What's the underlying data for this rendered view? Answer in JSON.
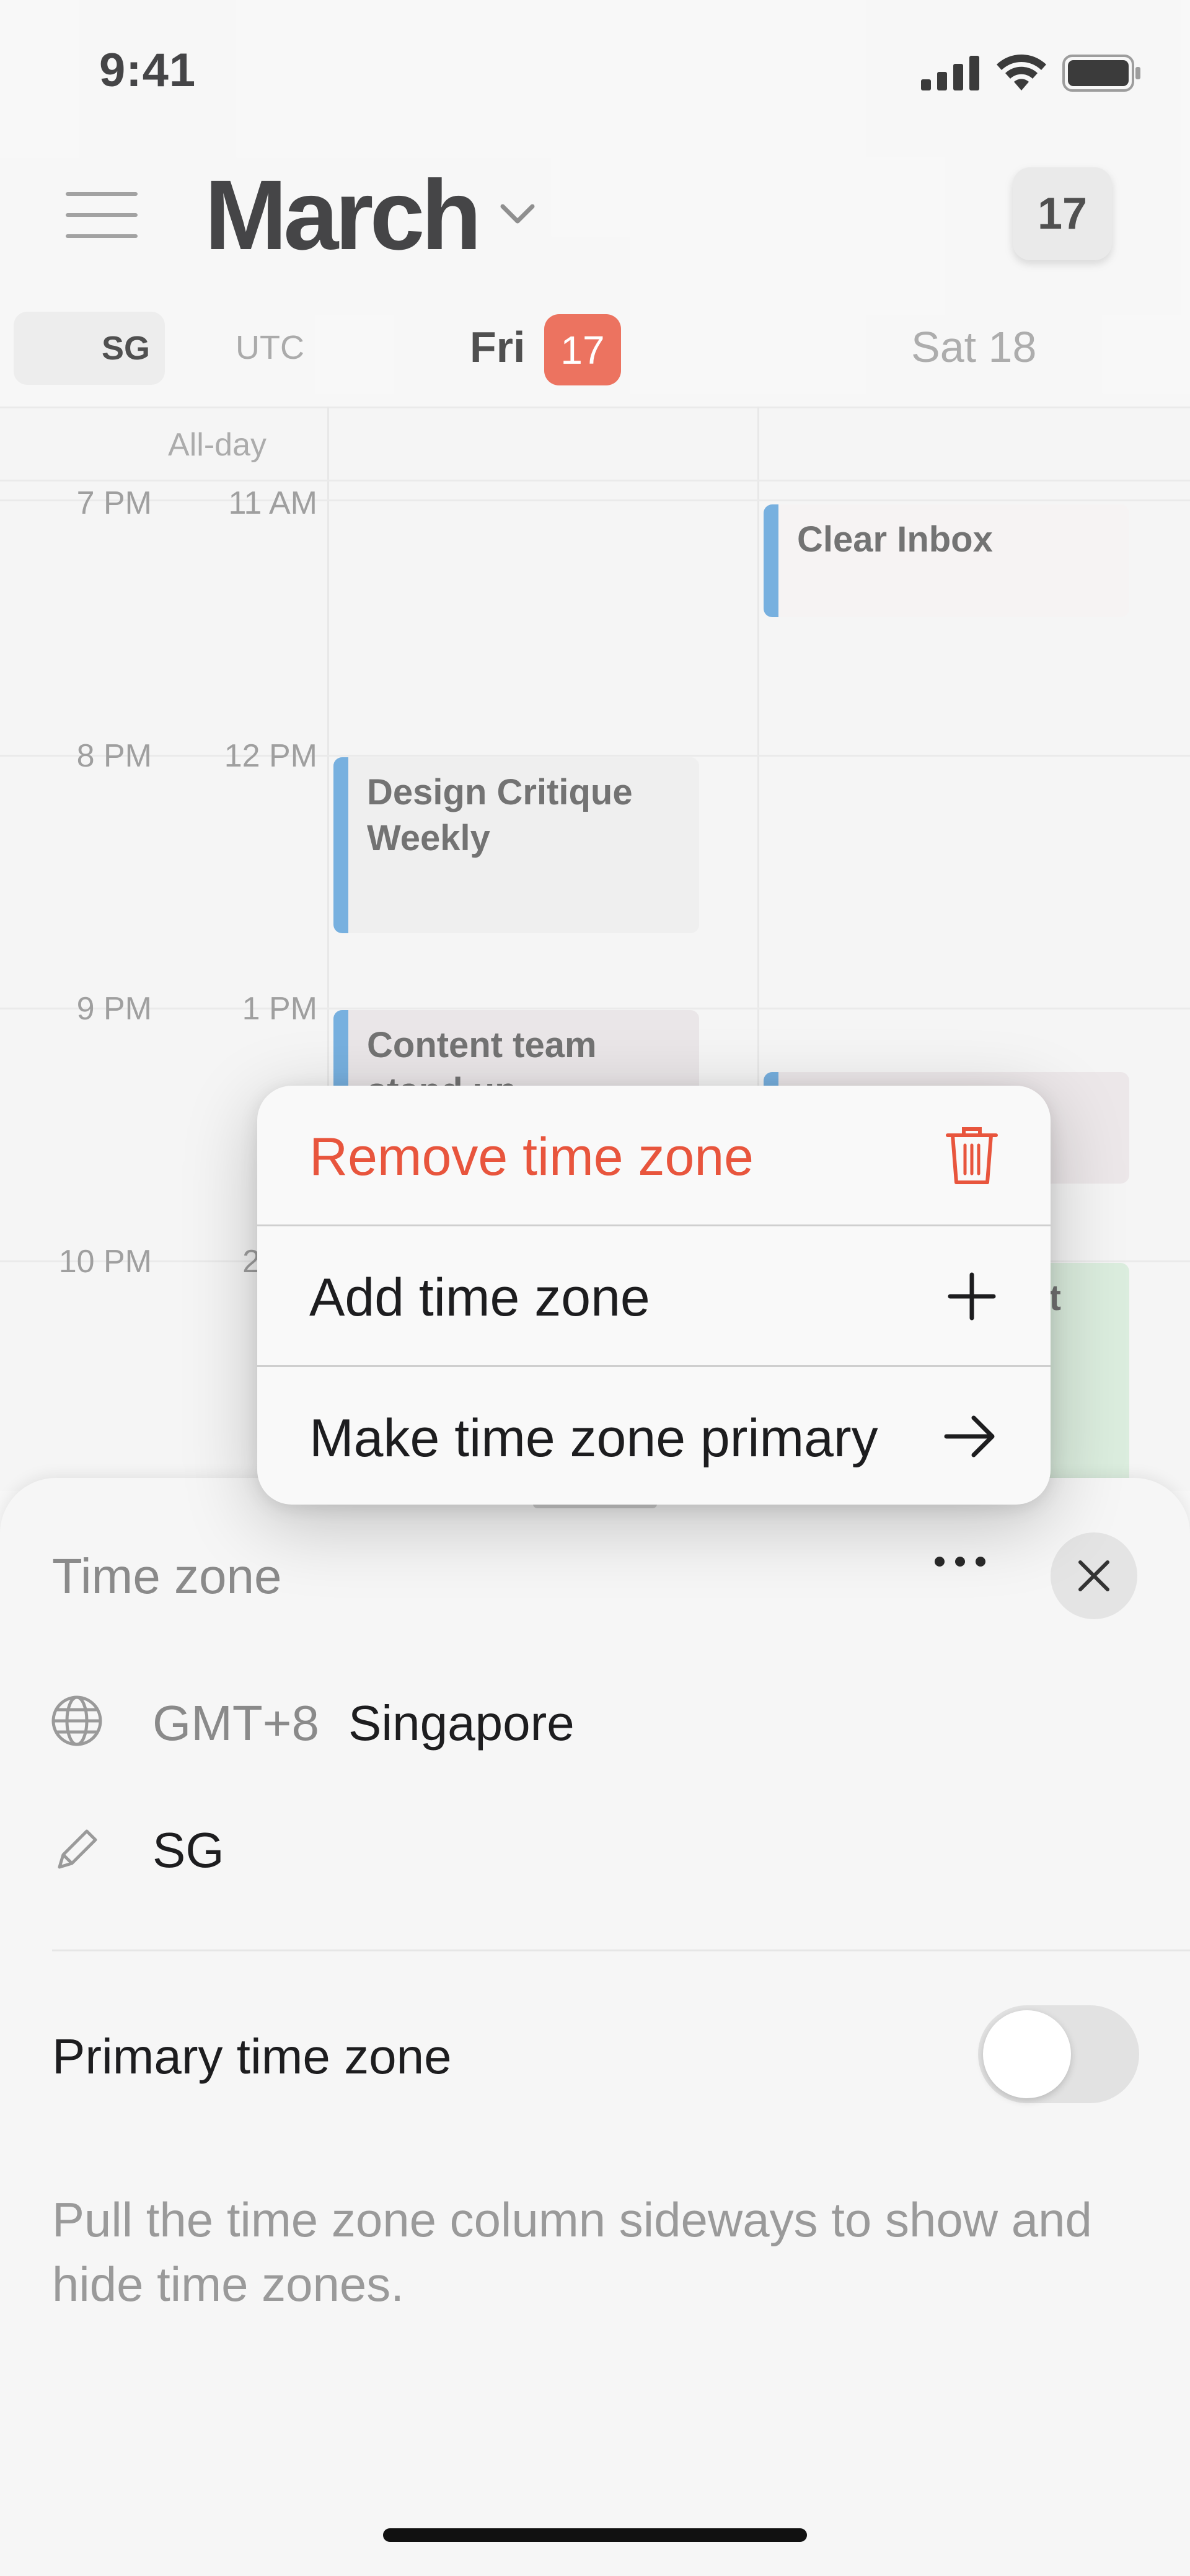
{
  "status_bar": {
    "time": "9:41"
  },
  "header": {
    "month": "March",
    "today_label": "17"
  },
  "timezones": {
    "primary": "SG",
    "secondary": "UTC"
  },
  "days": {
    "fri_label": "Fri",
    "fri_date": "17",
    "sat_label": "Sat 18"
  },
  "grid": {
    "allday_label": "All-day",
    "hours": [
      {
        "sg": "7 PM",
        "utc": "11 AM"
      },
      {
        "sg": "8 PM",
        "utc": "12 PM"
      },
      {
        "sg": "9 PM",
        "utc": "1 PM"
      },
      {
        "sg": "10 PM",
        "utc": "2"
      }
    ],
    "events": [
      {
        "title": "Clear Inbox",
        "color": "#5a9fd8"
      },
      {
        "title": "Design Critique Weekly",
        "color": "#5a9fd8"
      },
      {
        "title": "Content team stand up",
        "color": "#5a9fd8"
      },
      {
        "title": "",
        "color": "#5a9fd8"
      },
      {
        "title": "t",
        "color": "#7cc68d"
      }
    ]
  },
  "context_menu": {
    "items": [
      {
        "label": "Remove time zone",
        "icon": "trash-icon",
        "color": "#e8553d"
      },
      {
        "label": "Add time zone",
        "icon": "plus-icon"
      },
      {
        "label": "Make time zone primary",
        "icon": "arrow-right-icon"
      }
    ]
  },
  "sheet": {
    "title": "Time zone",
    "offset": "GMT+8",
    "city": "Singapore",
    "abbreviation": "SG",
    "primary_label": "Primary time zone",
    "primary_enabled": false,
    "help": "Pull the time zone column sideways to show and hide time zones."
  },
  "colors": {
    "accent": "#e8553d",
    "event_blue": "#5a9fd8",
    "event_green": "#7cc68d"
  }
}
